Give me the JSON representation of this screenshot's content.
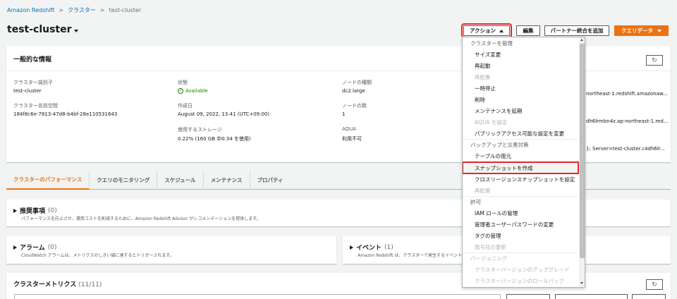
{
  "breadcrumb": {
    "root": "Amazon Redshift",
    "level1": "クラスター",
    "current": "test-cluster"
  },
  "page": {
    "title": "test-cluster"
  },
  "header_buttons": {
    "action": "アクション",
    "edit": "編集",
    "partner": "パートナー統合を追加",
    "query": "クエリデータ"
  },
  "general": {
    "title": "一般的な情報",
    "cluster_id_label": "クラスター識別子",
    "cluster_id": "test-cluster",
    "namespace_label": "クラスター名前空間",
    "namespace": "184f8c6e-7813-47d8-b4bf-28e110531643",
    "status_label": "状態",
    "status": "Available",
    "created_label": "作成日",
    "created": "August 09, 2022, 13:41 (UTC+09:00)",
    "storage_label": "使用するストレージ",
    "storage": "0.22% (160 GB 中0.34 を使用)",
    "node_type_label": "ノードの種類",
    "node_type": "dc2.large",
    "node_count_label": "ノードの数",
    "node_count": "1",
    "aqua_label": "AQUA",
    "aqua": "利用不可",
    "endpoint": "northeast-1.redshift.amazonaw...",
    "jdbc": "dh6lrmbn4z.ap-northeast-1.red...",
    "odbc": "}; Server=test-cluster.c4dh6lr..."
  },
  "tabs": [
    "クラスターのパフォーマンス",
    "クエリのモニタリング",
    "スケジュール",
    "メンテナンス",
    "プロパティ"
  ],
  "recommendations": {
    "title": "推奨事項",
    "count": "(0)",
    "desc": "パフォーマンスを向上させ、運用コストを削減するために、Amazon Redshift Advisor がレコメンデーションを提供します。"
  },
  "alarms": {
    "title": "アラーム",
    "count": "(0)",
    "desc": "CloudWatch アラームは、メトリクスのしきい値に達するとトリガーされます。"
  },
  "events": {
    "title": "イベント",
    "count": "(1)",
    "desc": "Amazon Redshift は、クラスターで発生するイベント..."
  },
  "metrics": {
    "title": "クラスターメトリクス",
    "count": "(11/11)"
  },
  "dropdown": {
    "g_manage": "クラスターを管理",
    "resize": "サイズ変更",
    "reboot": "再起動",
    "relocate": "再配置",
    "pause": "一時停止",
    "delete": "削除",
    "maint": "メンテナンスを延期",
    "aqua": "AQUA を設定",
    "public": "パブリックアクセス可能な設定を変更",
    "g_backup": "バックアップと災害対策",
    "restore_table": "テーブルの復元",
    "create_snapshot": "スナップショットを作成",
    "cross_region": "クロスリージョンスナップショットを設定",
    "relocate2": "再配置",
    "g_perm": "許可",
    "iam": "IAM ロールの管理",
    "admin_pw": "管理者ユーザーパスワードの変更",
    "tags": "タグの管理",
    "rotate": "暗号化の更新",
    "g_version": "バージョニング",
    "upgrade": "クラスターバージョンのアップグレード",
    "rollback": "クラスターバージョンのロールバック"
  }
}
